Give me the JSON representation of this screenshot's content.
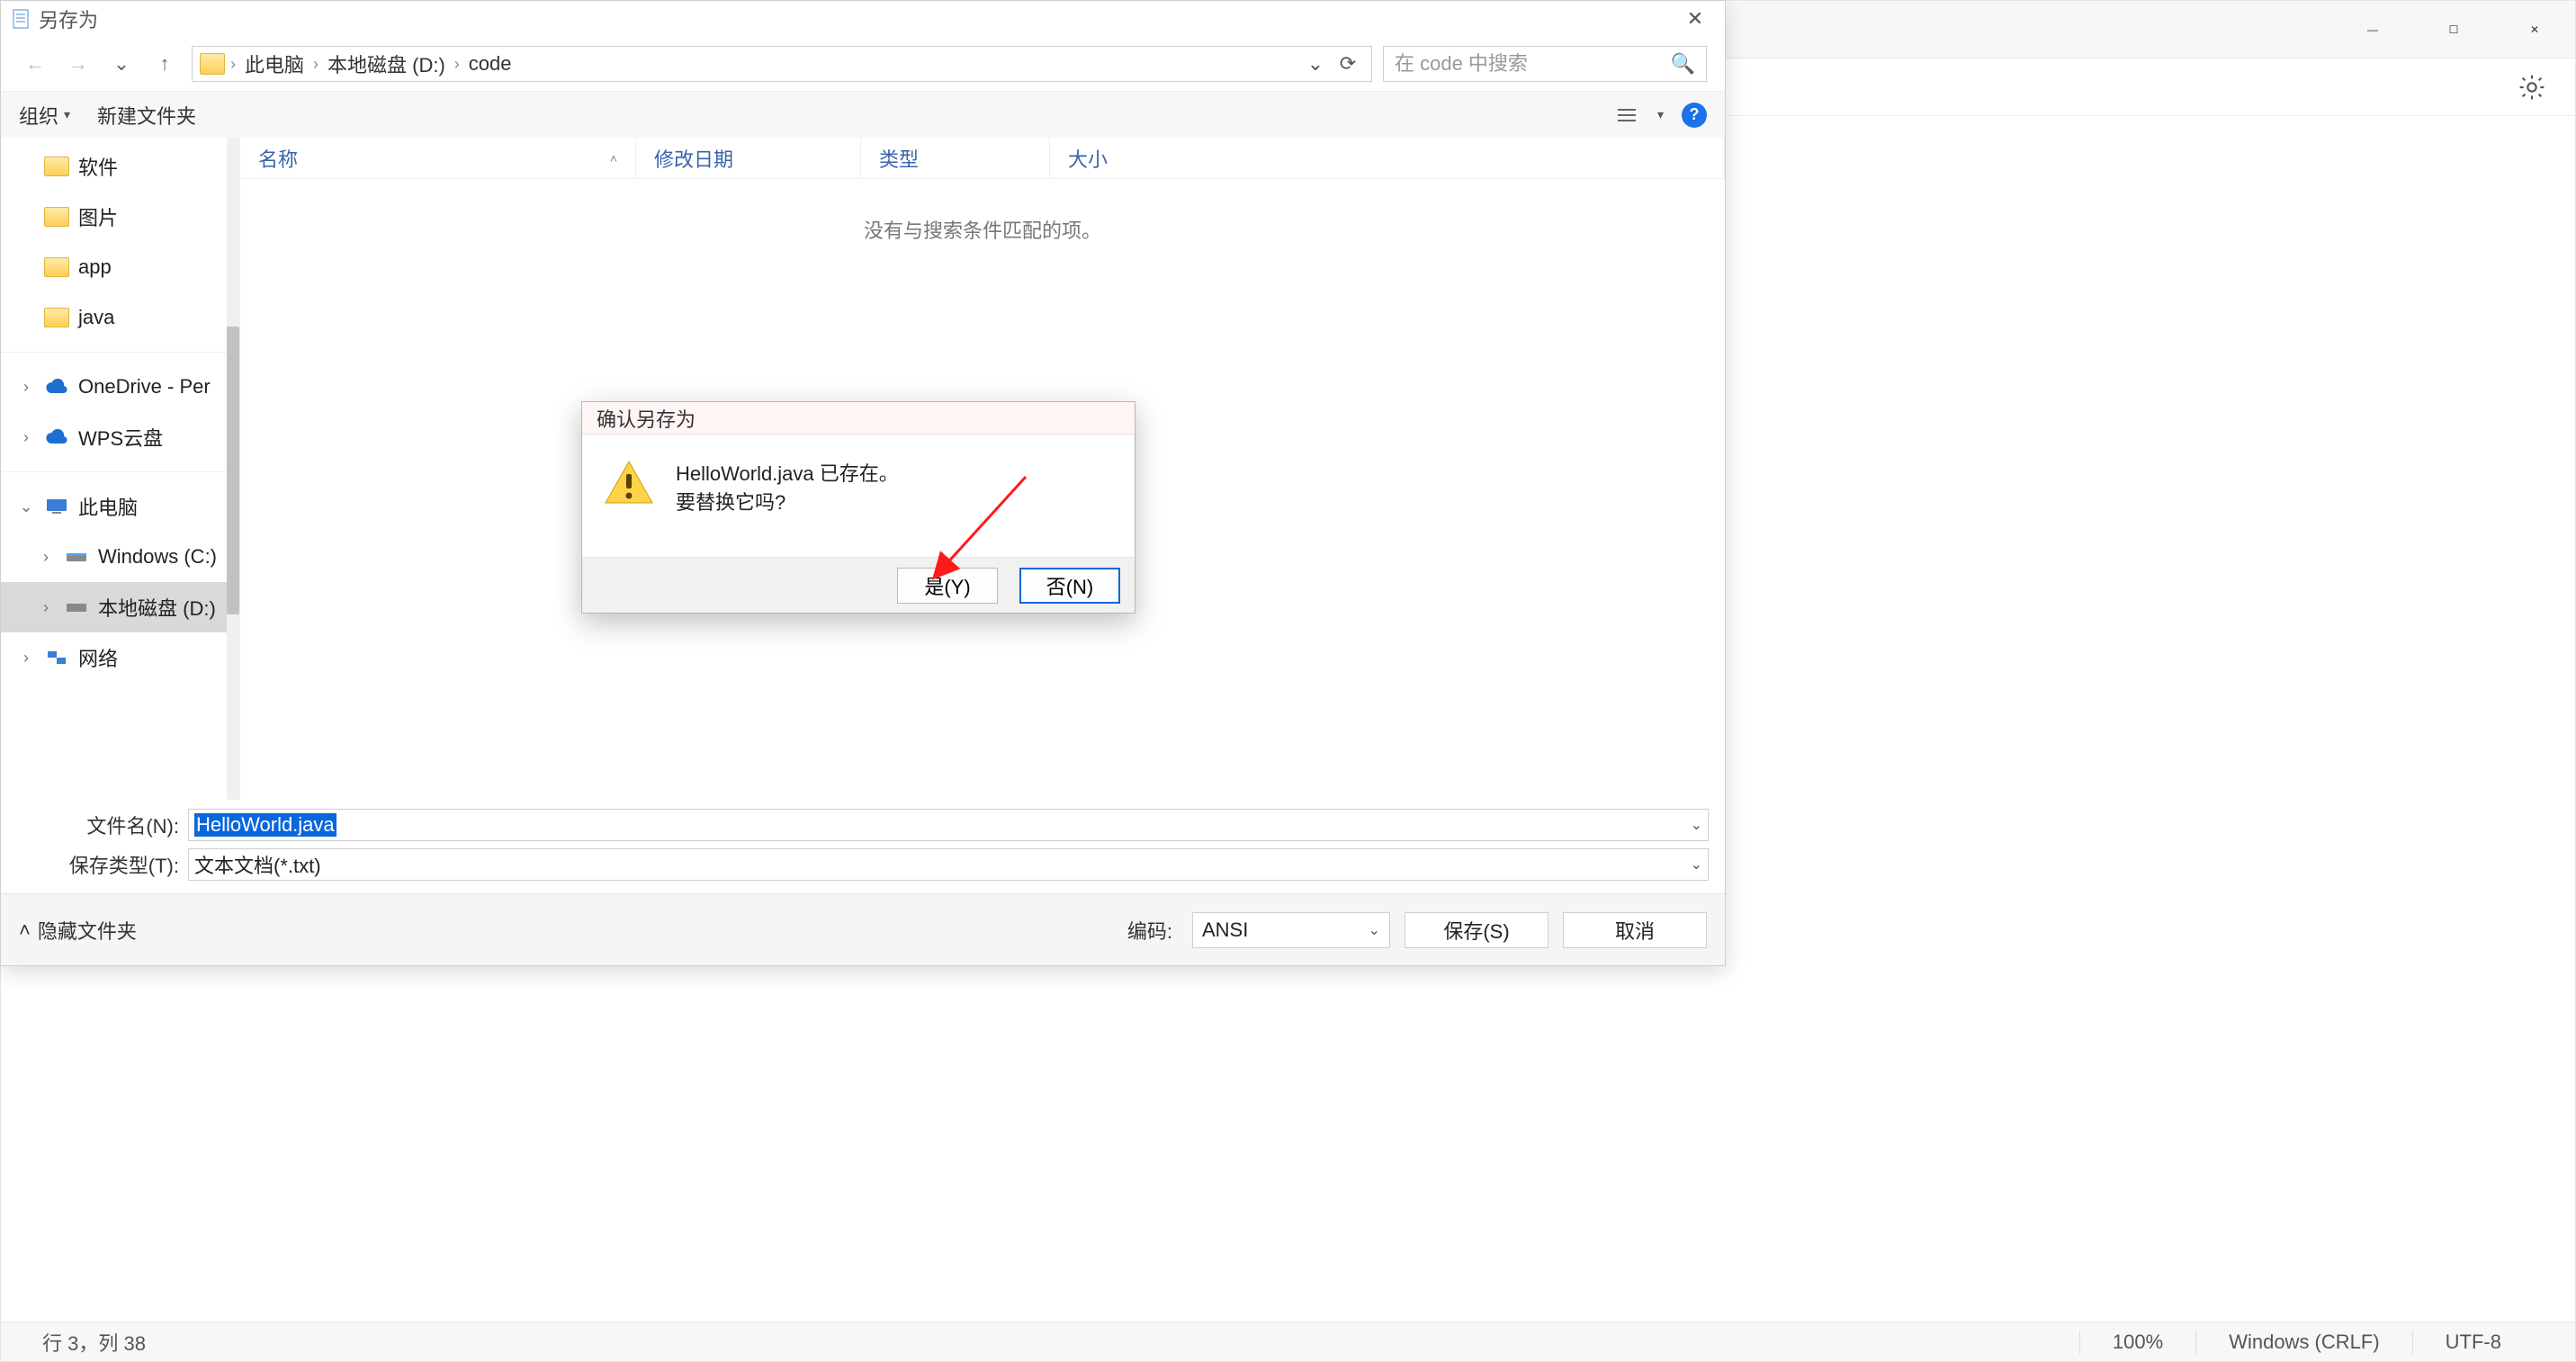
{
  "app": {
    "status_pos": "行 3，列 38",
    "status_zoom": "100%",
    "status_eol": "Windows (CRLF)",
    "status_enc": "UTF-8",
    "win_min": "—",
    "win_max": "☐",
    "win_close": "✕"
  },
  "dialog": {
    "title": "另存为",
    "close_glyph": "✕",
    "nav_back": "←",
    "nav_fwd": "→",
    "nav_recent": "⌄",
    "nav_up": "↑",
    "breadcrumb": {
      "root": "此电脑",
      "drive": "本地磁盘 (D:)",
      "folder": "code"
    },
    "addr_dd": "⌄",
    "addr_refresh": "⟳",
    "search_placeholder": "在 code 中搜索",
    "search_icon": "🔍",
    "toolbar": {
      "organize": "组织",
      "newfolder": "新建文件夹",
      "help": "?"
    },
    "tree": {
      "quick": {
        "soft": "软件",
        "pic": "图片",
        "app": "app",
        "java": "java"
      },
      "cloud": {
        "onedrive": "OneDrive - Per",
        "wps": "WPS云盘"
      },
      "thispc": "此电脑",
      "drive_c": "Windows (C:)",
      "drive_d": "本地磁盘 (D:)",
      "network": "网络"
    },
    "columns": {
      "name": "名称",
      "date": "修改日期",
      "type": "类型",
      "size": "大小"
    },
    "empty_msg": "没有与搜索条件匹配的项。",
    "filename_label": "文件名(N):",
    "filename_value": "HelloWorld.java",
    "filetype_label": "保存类型(T):",
    "filetype_value": "文本文档(*.txt)",
    "hide_folders": "隐藏文件夹",
    "encoding_label": "编码:",
    "encoding_value": "ANSI",
    "save_btn": "保存(S)",
    "cancel_btn": "取消"
  },
  "modal": {
    "title": "确认另存为",
    "line1": "HelloWorld.java 已存在。",
    "line2": "要替换它吗?",
    "yes": "是(Y)",
    "no": "否(N)"
  }
}
